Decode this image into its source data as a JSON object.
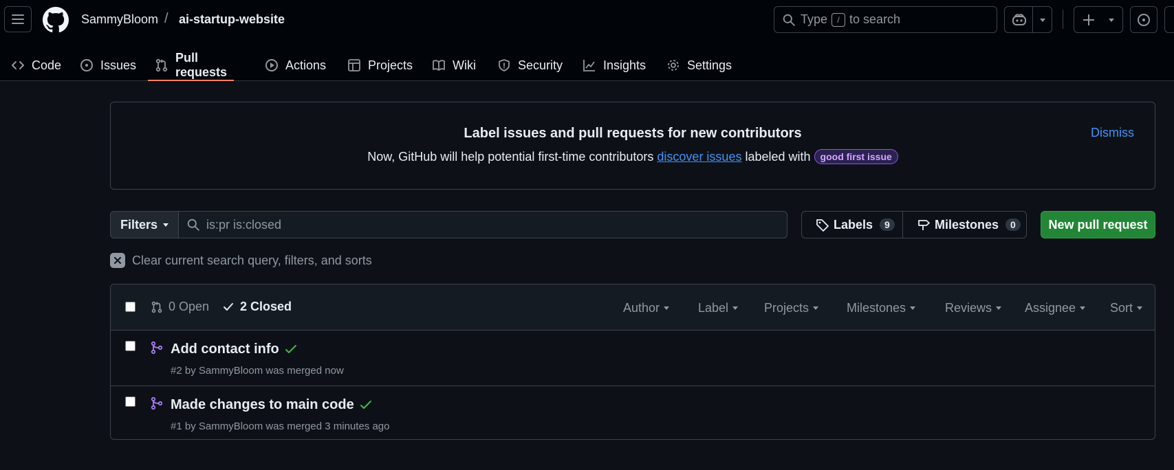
{
  "header": {
    "owner": "SammyBloom",
    "separator": "/",
    "repo": "ai-startup-website",
    "search": {
      "prefix": "Type",
      "key": "/",
      "suffix": "to search"
    }
  },
  "tabs": [
    {
      "label": "Code",
      "icon": "code-icon"
    },
    {
      "label": "Issues",
      "icon": "issue-opened-icon"
    },
    {
      "label": "Pull requests",
      "icon": "git-pull-request-icon",
      "active": true
    },
    {
      "label": "Actions",
      "icon": "play-icon"
    },
    {
      "label": "Projects",
      "icon": "table-icon"
    },
    {
      "label": "Wiki",
      "icon": "book-icon"
    },
    {
      "label": "Security",
      "icon": "shield-icon"
    },
    {
      "label": "Insights",
      "icon": "graph-icon"
    },
    {
      "label": "Settings",
      "icon": "gear-icon"
    }
  ],
  "banner": {
    "title": "Label issues and pull requests for new contributors",
    "desc_before": "Now, GitHub will help potential first-time contributors",
    "desc_link": "discover issues",
    "desc_after": "labeled with",
    "label": "good first issue",
    "dismiss": "Dismiss"
  },
  "filterbar": {
    "filters_label": "Filters",
    "query": "is:pr is:closed",
    "labels_label": "Labels",
    "labels_count": "9",
    "milestones_label": "Milestones",
    "milestones_count": "0",
    "new_pr_label": "New pull request"
  },
  "clear_label": "Clear current search query, filters, and sorts",
  "list": {
    "open_label": "0 Open",
    "closed_label": "2 Closed",
    "filters": [
      "Author",
      "Label",
      "Projects",
      "Milestones",
      "Reviews",
      "Assignee",
      "Sort"
    ],
    "rows": [
      {
        "title": "Add contact info",
        "meta": "#2 by SammyBloom was merged now"
      },
      {
        "title": "Made changes to main code",
        "meta": "#1 by SammyBloom was merged 3 minutes ago"
      }
    ]
  },
  "colors": {
    "background": "#0d1117",
    "header_bg": "#010409",
    "accent_underline": "#f78166",
    "link": "#4493f8",
    "merged": "#ab7df8",
    "success": "#3fb950",
    "primary_button": "#238636"
  }
}
